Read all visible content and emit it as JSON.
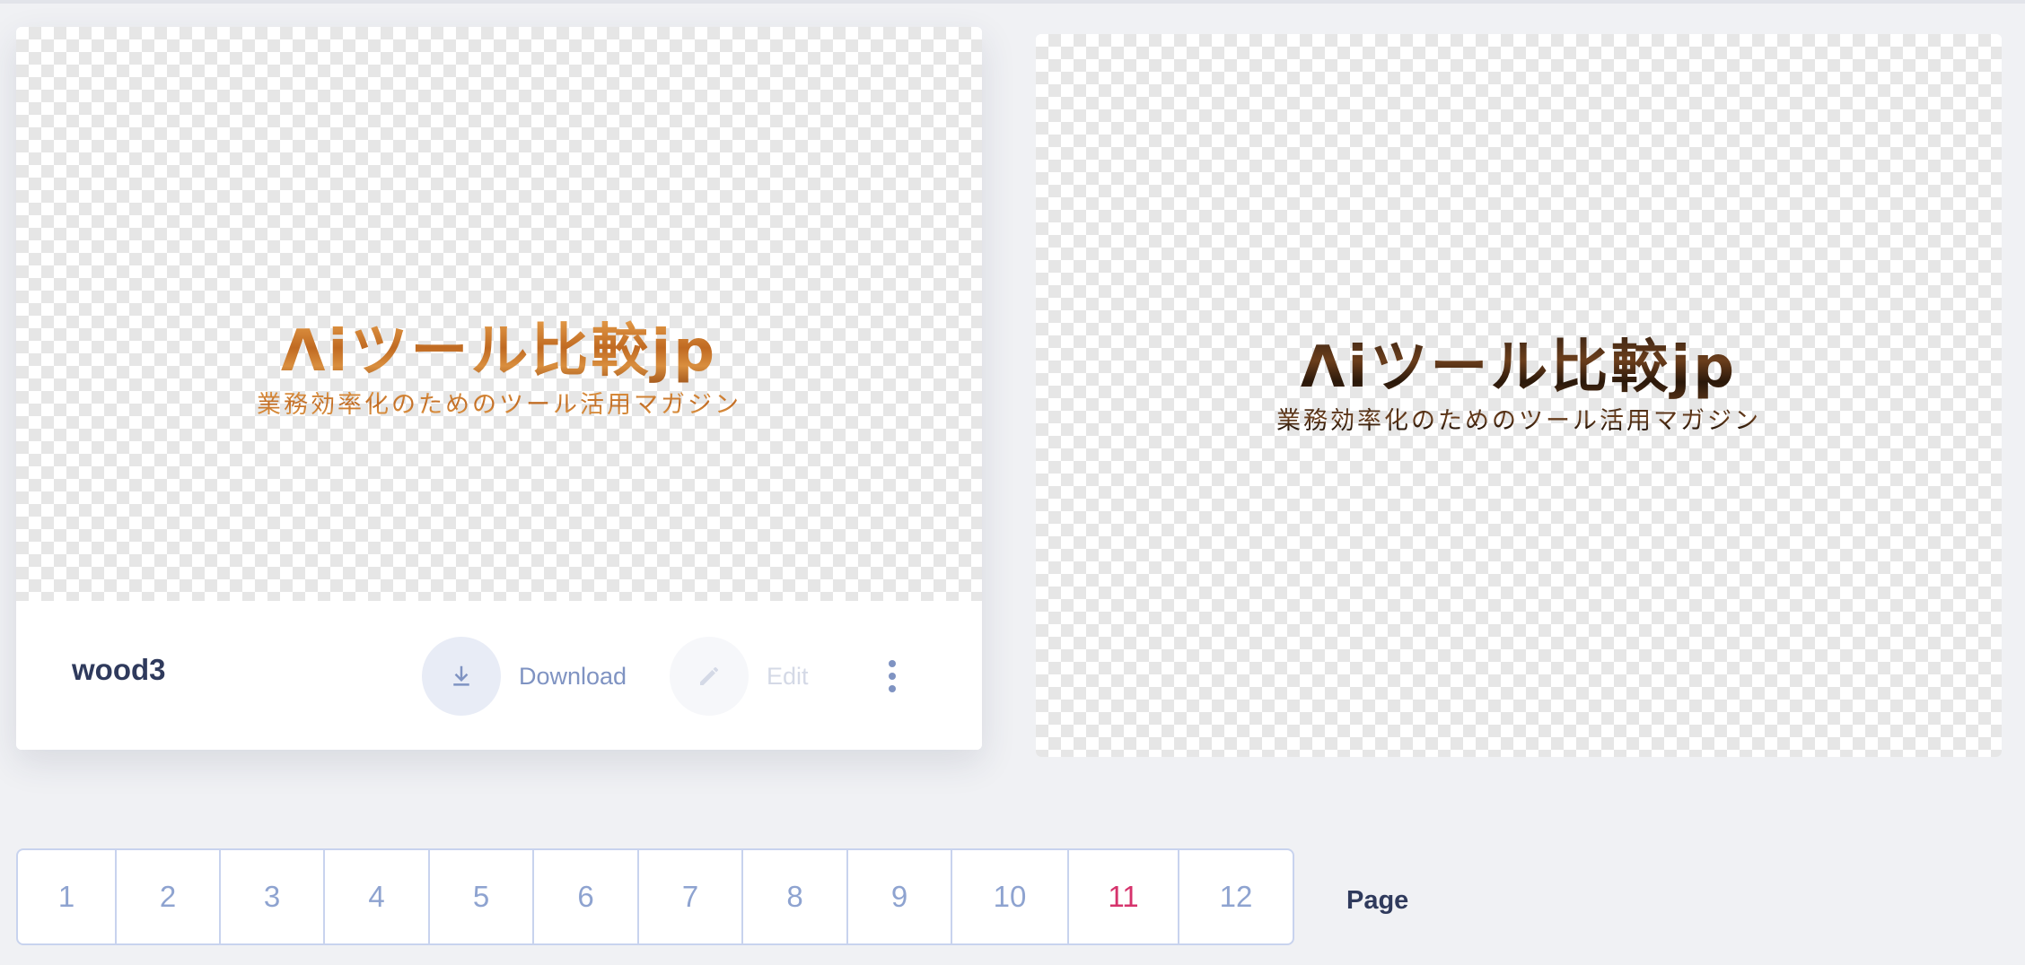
{
  "card_left": {
    "name": "wood3",
    "logo_title": "Λiツール比較jp",
    "logo_subtitle": "業務効率化のためのツール活用マガジン",
    "download_label": "Download",
    "edit_label": "Edit",
    "icons": {
      "download": "download-icon",
      "edit": "pencil-icon",
      "more": "more-vertical-icon"
    }
  },
  "card_right": {
    "logo_title": "Λiツール比較jp",
    "logo_subtitle": "業務効率化のためのツール活用マガジン"
  },
  "pagination": {
    "pages": [
      "1",
      "2",
      "3",
      "4",
      "5",
      "6",
      "7",
      "8",
      "9",
      "10",
      "11",
      "12"
    ],
    "current": "11",
    "label": "Page"
  },
  "colors": {
    "background": "#f0f1f4",
    "accent": "#7f93c2",
    "active_page": "#d6336c",
    "text_dark": "#2f3a5c"
  }
}
